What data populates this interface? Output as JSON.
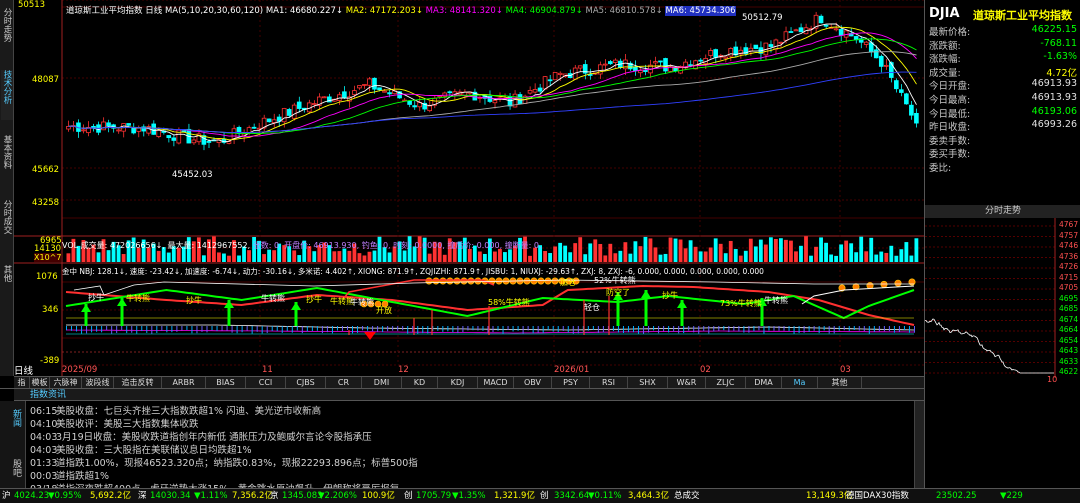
{
  "left_tabs": [
    "分时走势",
    "技术分析",
    "基本资料",
    "分时成交",
    "其他"
  ],
  "chart": {
    "header_title": "道琼斯工业平均指数",
    "period": "日线",
    "ma_params": "MA(5,10,20,30,60,120)",
    "ma1": "MA1: 46680.227↓",
    "ma2": "MA2: 47172.203↓",
    "ma3": "MA3: 48141.320↓",
    "ma4": "MA4: 46904.879↓",
    "ma5": "MA5: 46810.578↓",
    "ma6": "MA6: 45734.306",
    "y_labels": [
      "50513",
      "48087",
      "45662",
      "43258"
    ],
    "high_label": "50512.79",
    "low_label": "45452.03",
    "vol_header": "VOL 成交量: 472026656↓, 最大量: 1412967552,",
    "vol_extra": "张数: 0, 开盘价: 46913.930, 钓鱼: 0, 时刻: 0.0000, 撞后价: 0.000, 撞断量: 0,",
    "vol_labels": [
      "14130",
      "6965",
      "X10^7"
    ],
    "ind_header": "金中 NBJ: 128.1↓, 速度: -23.42↓, 加速度: -6.74↓, 动力: -30.16↓, 多米诺: 4.402↑, XIONG: 871.9↑, ZQJIZHI: 871.9↑, JISBU: 1, NIUXJ: -29.63↑, ZXJ: 8, ZXJ: -6, 0.000, 0.000, 0.000, 0.000, 0.000",
    "ind_labels": [
      "1076",
      "346",
      "-389"
    ],
    "ind_annotations": [
      "抄牛",
      "牛转熊",
      "抄牛",
      "牛转熊",
      "抄牛",
      "牛转熊",
      "牛转熊",
      "开放",
      "58%牛转熊",
      "52%牛转熊",
      "加仓",
      "防空了",
      "轻仓",
      "抄牛",
      "73%牛转熊",
      "牛转熊"
    ],
    "date_labels": [
      "2025/09",
      "11",
      "12",
      "2026/01",
      "02",
      "03"
    ],
    "day_label": "日线"
  },
  "indicator_tabs": [
    "指标",
    "模板",
    "六脉神剑",
    "波段线",
    "追击反转",
    "ARBR",
    "BIAS",
    "CCI",
    "CJBS",
    "CR",
    "DMI",
    "KD",
    "KDJ",
    "MACD",
    "OBV",
    "PSY",
    "RSI",
    "SHX",
    "W&R",
    "ZLJC",
    "DMA",
    "Ma",
    "其他"
  ],
  "quote": {
    "code": "DJIA",
    "name": "道琼斯工业平均指数",
    "rows": [
      {
        "label": "最新价格:",
        "value": "46225.15"
      },
      {
        "label": "涨跌额:",
        "value": "-768.11"
      },
      {
        "label": "涨跌幅:",
        "value": "-1.63%"
      },
      {
        "label": "成交量:",
        "value": "4.72亿"
      },
      {
        "label": "今日开盘:",
        "value": "46913.93"
      },
      {
        "label": "今日最高:",
        "value": "46913.93"
      },
      {
        "label": "今日最低:",
        "value": "46193.06"
      },
      {
        "label": "昨日收盘:",
        "value": "46993.26"
      },
      {
        "label": "委卖手数:",
        "value": ""
      },
      {
        "label": "委买手数:",
        "value": ""
      },
      {
        "label": "委比:",
        "value": ""
      }
    ],
    "timeshare_title": "分时走势",
    "ts_labels": [
      "4767",
      "4757",
      "4746",
      "4736",
      "4726",
      "4715",
      "4705",
      "4695",
      "4685",
      "4674",
      "4664",
      "4654",
      "4643",
      "4633",
      "4622"
    ],
    "ts_time": "10"
  },
  "news": {
    "tab_label": "指数资讯",
    "side_tabs": [
      "新闻",
      "股吧"
    ],
    "items": [
      {
        "time": "06:15",
        "text": "美股收盘：七巨头齐挫三大指数跌超1% 闪迪、美光逆市收新高"
      },
      {
        "time": "04:10",
        "text": "美股收评：美股三大指数集体收跌"
      },
      {
        "time": "04:03",
        "text": "3月19日收盘：美股收跌道指创年内新低 通胀压力及鲍威尔言论令股指承压"
      },
      {
        "time": "04:03",
        "text": "美股收盘：三大股指在美联储议息日均跌超1%"
      },
      {
        "time": "01:33",
        "text": "道指跌1.00%，现报46523.320点；纳指跌0.83%，现报22293.896点；标普500指"
      },
      {
        "time": "00:03",
        "text": "道指跌超1%"
      },
      {
        "time": "03/18",
        "text": "道指深夜跌超400点，虎牙逆势大涨15%，黄金跳水原油飙升，伊朗称将严厉报复"
      }
    ]
  },
  "status": [
    {
      "text": "沪",
      "color": "#ffffff"
    },
    {
      "text": "4024.23",
      "color": "#00ff00"
    },
    {
      "text": "▼0.95%",
      "color": "#00ff00"
    },
    {
      "text": "5,692.2亿",
      "color": "#ffff00"
    },
    {
      "text": "深",
      "color": "#ffffff"
    },
    {
      "text": "14030.34",
      "color": "#00ff00"
    },
    {
      "text": "▼1.11%",
      "color": "#00ff00"
    },
    {
      "text": "7,356.2亿",
      "color": "#ffff00"
    },
    {
      "text": "京",
      "color": "#ffffff"
    },
    {
      "text": "1345.083",
      "color": "#00ff00"
    },
    {
      "text": "▼2.206%",
      "color": "#00ff00"
    },
    {
      "text": "100.9亿",
      "color": "#ffff00"
    },
    {
      "text": "创",
      "color": "#ffffff"
    },
    {
      "text": "1705.79",
      "color": "#00ff00"
    },
    {
      "text": "▼1.35%",
      "color": "#00ff00"
    },
    {
      "text": "1,321.9亿",
      "color": "#ffff00"
    },
    {
      "text": "创",
      "color": "#ffffff"
    },
    {
      "text": "3342.64",
      "color": "#00ff00"
    },
    {
      "text": "▼0.11%",
      "color": "#00ff00"
    },
    {
      "text": "3,464.3亿",
      "color": "#ffff00"
    },
    {
      "text": "总成交",
      "color": "#ffffff"
    },
    {
      "text": "13,149.3亿",
      "color": "#ffff00"
    },
    {
      "text": "德国DAX30指数",
      "color": "#ffffff"
    },
    {
      "text": "23502.25",
      "color": "#00ff00"
    },
    {
      "text": "▼229",
      "color": "#00ff00"
    }
  ],
  "colors": {
    "up": "#ff3232",
    "down": "#00ffff",
    "ma1": "#ffffff",
    "ma2": "#ffff00",
    "ma3": "#ff00ff",
    "ma4": "#00ff00",
    "ma5": "#aaaaaa",
    "ma6": "#3040ff"
  }
}
